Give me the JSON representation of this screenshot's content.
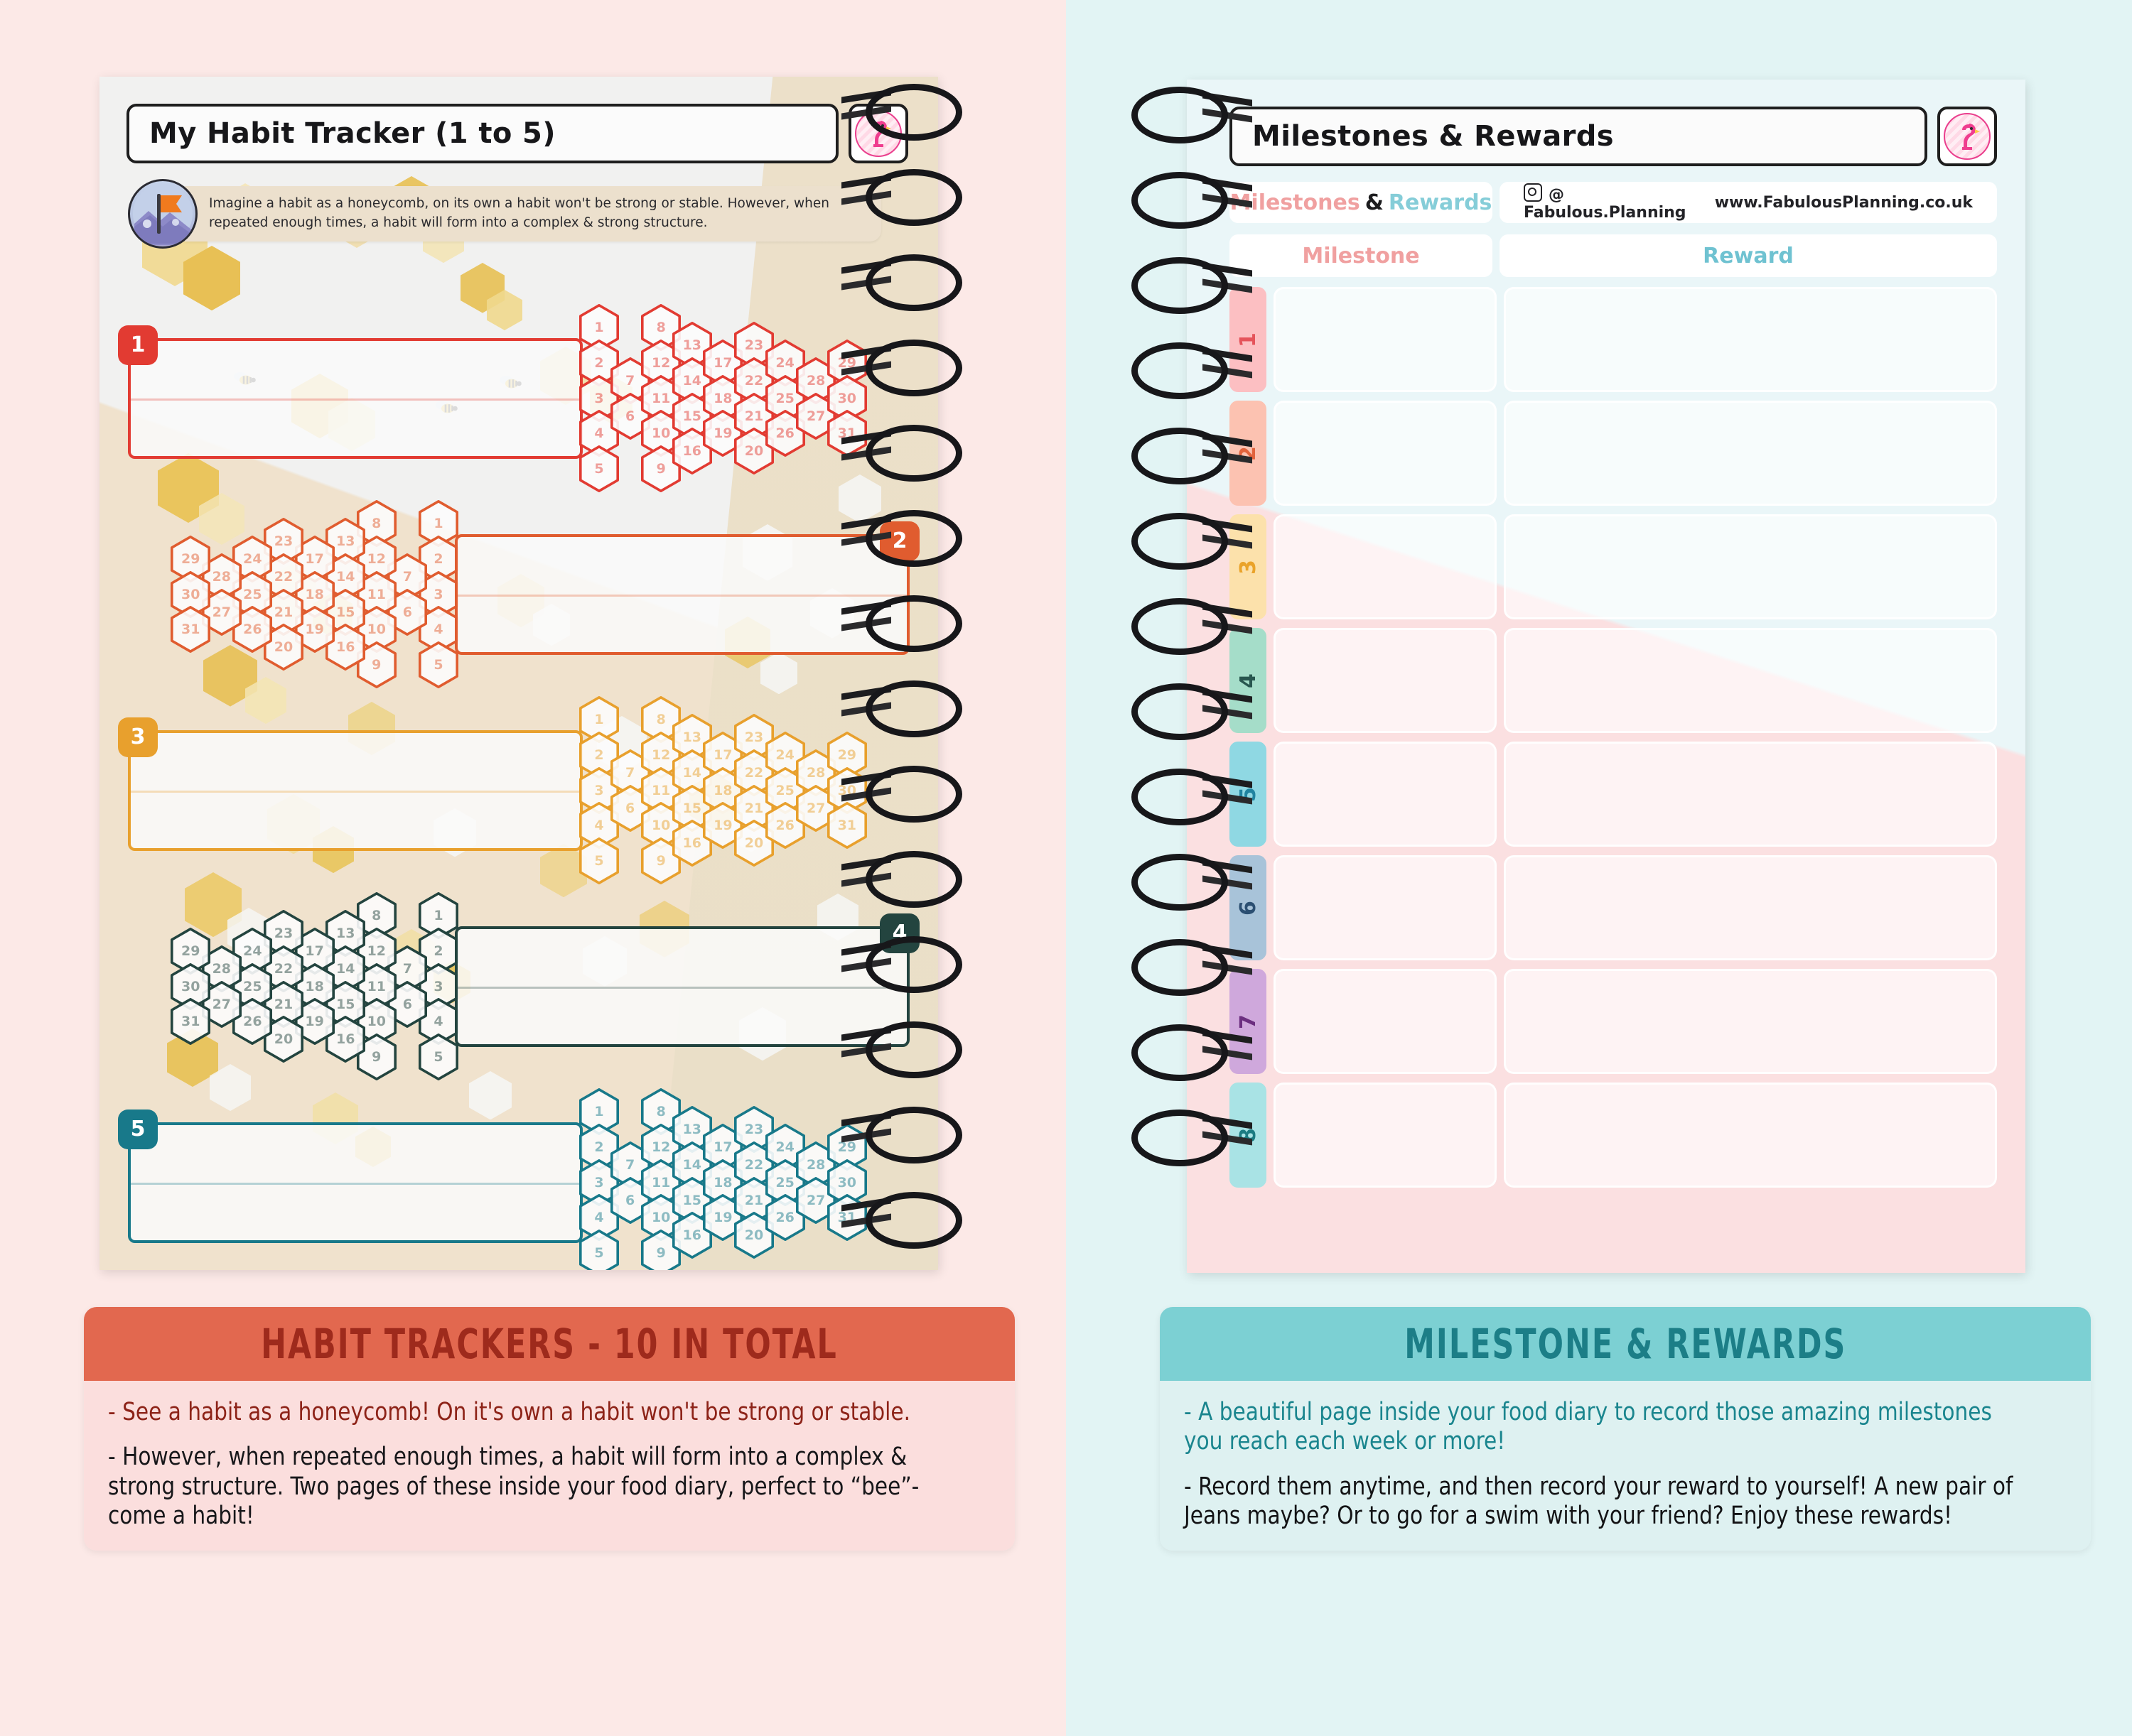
{
  "left_page": {
    "title": "My Habit Tracker (1 to 5)",
    "logo_icon": "flamingo-icon",
    "info_note": {
      "icon": "flag-mountain-icon",
      "text": "Imagine a habit as a honeycomb, on its own a habit won't be strong or stable. However, when repeated enough times, a habit will form into a complex & strong structure."
    },
    "habit_rows": [
      {
        "number": "1",
        "color": "#e23b32",
        "mirrored": false
      },
      {
        "number": "2",
        "color": "#e05c2f",
        "mirrored": true
      },
      {
        "number": "3",
        "color": "#e8a02d",
        "mirrored": false
      },
      {
        "number": "4",
        "color": "#23443f",
        "mirrored": true
      },
      {
        "number": "5",
        "color": "#18798a",
        "mirrored": false
      }
    ],
    "hex_numbers": [
      1,
      2,
      3,
      4,
      5,
      6,
      7,
      8,
      9,
      10,
      11,
      12,
      13,
      14,
      15,
      16,
      17,
      18,
      19,
      20,
      21,
      22,
      23,
      24,
      25,
      26,
      27,
      28,
      29,
      30,
      31
    ]
  },
  "right_page": {
    "title": "Milestones & Rewards",
    "logo_icon": "flamingo-icon",
    "brand": {
      "title_w1": "Milestones",
      "title_w2": "&",
      "title_w3": "Rewards",
      "instagram_icon": "instagram-icon",
      "instagram_handle": "@ Fabulous.Planning",
      "website": "www.FabulousPlanning.co.uk"
    },
    "columns": {
      "milestone": "Milestone",
      "reward": "Reward"
    },
    "rows": [
      {
        "number": "1",
        "tab_bg": "#fcbfc2",
        "tab_fg": "#e5535a"
      },
      {
        "number": "2",
        "tab_bg": "#fcc2b1",
        "tab_fg": "#e2633c"
      },
      {
        "number": "3",
        "tab_bg": "#fce1ab",
        "tab_fg": "#eaa32a"
      },
      {
        "number": "4",
        "tab_bg": "#a5ddc9",
        "tab_fg": "#28564f"
      },
      {
        "number": "5",
        "tab_bg": "#8fd8e3",
        "tab_fg": "#2083a0"
      },
      {
        "number": "6",
        "tab_bg": "#a8c3d9",
        "tab_fg": "#2b4f72"
      },
      {
        "number": "7",
        "tab_bg": "#cfa8dc",
        "tab_fg": "#6c2f80"
      },
      {
        "number": "8",
        "tab_bg": "#a9e3e5",
        "tab_fg": "#1c7b82"
      }
    ]
  },
  "captions": {
    "left": {
      "heading": "HABIT TRACKERS - 10 IN TOTAL",
      "para1": "- See a habit as a honeycomb! On it's own a habit won't be strong or stable.",
      "para2": "- However, when repeated enough times, a habit will form into a complex & strong structure. Two pages of these inside your food diary, perfect to “bee”-come a habit!"
    },
    "right": {
      "heading": "MILESTONE & REWARDS",
      "para1": "- A beautiful page inside your food diary to record those amazing milestones you reach each week or more!",
      "para2": "- Record them anytime, and then record your reward to yourself! A new pair of Jeans maybe? Or to go for a swim with your friend? Enjoy these rewards!"
    }
  },
  "colors": {
    "left_bg": "#fce9e7",
    "right_bg": "#e2f4f4",
    "left_banner": "#e2684f",
    "right_banner": "#7cd0d3"
  }
}
